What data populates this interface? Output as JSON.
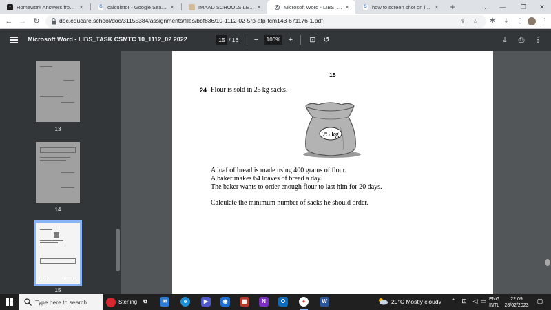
{
  "browser": {
    "tabs": [
      {
        "title": "Homework Answers from Su",
        "icon": "bookmark-icon",
        "color": "#1a1a1a"
      },
      {
        "title": "calculator - Google Search",
        "icon": "google-icon",
        "color": "#4285f4"
      },
      {
        "title": "IMAAD SCHOOLS LEKKI | My",
        "icon": "school-icon",
        "color": "#d0bc9a"
      },
      {
        "title": "Microsoft Word - LIBS_TASK",
        "icon": "globe-icon",
        "color": "#5f6368"
      },
      {
        "title": "how to screen shot on lapto",
        "icon": "google-icon",
        "color": "#4285f4"
      }
    ],
    "url": "doc.educare.school/doc/31155384/assignments/files/bbf836/10-1112-02-5rp-afp-tcm143-671176-1.pdf"
  },
  "pdf": {
    "title": "Microsoft Word - LIBS_TASK CSMTC 10_1112_02 2022",
    "current_page": "15",
    "page_count": "/ 16",
    "zoom": "100%"
  },
  "thumbnails": [
    {
      "label": "13"
    },
    {
      "label": "14"
    },
    {
      "label": "15"
    }
  ],
  "page": {
    "number": "15",
    "question_number": "24",
    "question_text": "Flour is sold in 25 kg sacks.",
    "sack_label": "25 kg",
    "lines": [
      "A loaf of bread is made using 400 grams of flour.",
      "A baker makes 64 loaves of bread a day.",
      "The baker wants to order enough flour to last him for 20 days.",
      "Calculate the minimum number of sacks he should order."
    ]
  },
  "taskbar": {
    "search_placeholder": "Type here to search",
    "news": "Sterling",
    "weather": "29°C  Mostly cloudy",
    "lang_line1": "ENG",
    "lang_line2": "INTL",
    "time": "22:09",
    "date": "28/02/2023"
  }
}
